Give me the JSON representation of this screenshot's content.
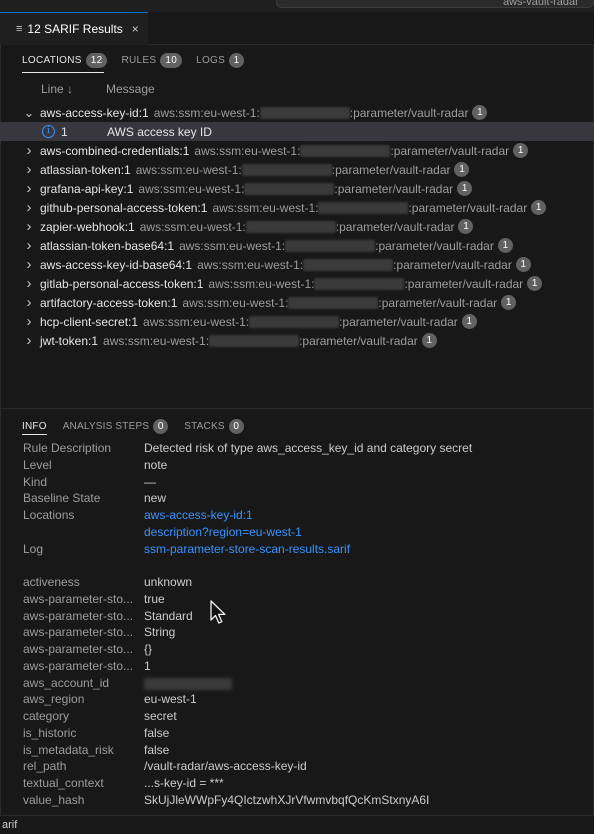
{
  "topbar": {
    "command_center_text": "aws-vault-radar"
  },
  "tab": {
    "icon": "list-icon",
    "title": "12 SARIF Results",
    "close": "×"
  },
  "subtabs": [
    {
      "label": "LOCATIONS",
      "count": "12",
      "active": true
    },
    {
      "label": "RULES",
      "count": "10",
      "active": false
    },
    {
      "label": "LOGS",
      "count": "1",
      "active": false
    }
  ],
  "columns": {
    "line": "Line",
    "sort_icon": "↓",
    "message": "Message"
  },
  "results": [
    {
      "name": "aws-access-key-id:1",
      "loc_prefix": "aws:ssm:eu-west-1:",
      "loc_suffix": ":parameter/vault-radar",
      "count": "1",
      "expanded": true
    },
    {
      "name": "aws-combined-credentials:1",
      "loc_prefix": "aws:ssm:eu-west-1:",
      "loc_suffix": ":parameter/vault-radar",
      "count": "1"
    },
    {
      "name": "atlassian-token:1",
      "loc_prefix": "aws:ssm:eu-west-1:",
      "loc_suffix": ":parameter/vault-radar",
      "count": "1"
    },
    {
      "name": "grafana-api-key:1",
      "loc_prefix": "aws:ssm:eu-west-1:",
      "loc_suffix": ":parameter/vault-radar",
      "count": "1"
    },
    {
      "name": "github-personal-access-token:1",
      "loc_prefix": "aws:ssm:eu-west-1:",
      "loc_suffix": ":parameter/vault-radar",
      "count": "1"
    },
    {
      "name": "zapier-webhook:1",
      "loc_prefix": "aws:ssm:eu-west-1:",
      "loc_suffix": ":parameter/vault-radar",
      "count": "1"
    },
    {
      "name": "atlassian-token-base64:1",
      "loc_prefix": "aws:ssm:eu-west-1:",
      "loc_suffix": ":parameter/vault-radar",
      "count": "1"
    },
    {
      "name": "aws-access-key-id-base64:1",
      "loc_prefix": "aws:ssm:eu-west-1:",
      "loc_suffix": ":parameter/vault-radar",
      "count": "1"
    },
    {
      "name": "gitlab-personal-access-token:1",
      "loc_prefix": "aws:ssm:eu-west-1:",
      "loc_suffix": ":parameter/vault-radar",
      "count": "1"
    },
    {
      "name": "artifactory-access-token:1",
      "loc_prefix": "aws:ssm:eu-west-1:",
      "loc_suffix": ":parameter/vault-radar",
      "count": "1"
    },
    {
      "name": "hcp-client-secret:1",
      "loc_prefix": "aws:ssm:eu-west-1:",
      "loc_suffix": ":parameter/vault-radar",
      "count": "1"
    },
    {
      "name": "jwt-token:1",
      "loc_prefix": "aws:ssm:eu-west-1:",
      "loc_suffix": ":parameter/vault-radar",
      "count": "1"
    }
  ],
  "child": {
    "icon": "info-icon",
    "line": "1",
    "message": "AWS access key ID"
  },
  "info_tabs": [
    {
      "label": "INFO",
      "active": true
    },
    {
      "label": "ANALYSIS STEPS",
      "count": "0"
    },
    {
      "label": "STACKS",
      "count": "0"
    }
  ],
  "info": [
    {
      "key": "Rule Description",
      "value": "Detected risk of type aws_access_key_id and category secret"
    },
    {
      "key": "Level",
      "value": "note"
    },
    {
      "key": "Kind",
      "value": "—"
    },
    {
      "key": "Baseline State",
      "value": "new"
    },
    {
      "key": "Locations",
      "value": "aws-access-key-id:1",
      "link": true
    },
    {
      "key": "",
      "value": "description?region=eu-west-1",
      "link": true
    },
    {
      "key": "Log",
      "value": "ssm-parameter-store-scan-results.sarif",
      "link": true
    },
    {
      "key": "",
      "value": ""
    },
    {
      "key": "activeness",
      "value": "unknown"
    },
    {
      "key": "aws-parameter-sto...",
      "value": "true"
    },
    {
      "key": "aws-parameter-sto...",
      "value": "Standard"
    },
    {
      "key": "aws-parameter-sto...",
      "value": "String"
    },
    {
      "key": "aws-parameter-sto...",
      "value": "{}"
    },
    {
      "key": "aws-parameter-sto...",
      "value": "1"
    },
    {
      "key": "aws_account_id",
      "value": "",
      "redacted": true
    },
    {
      "key": "aws_region",
      "value": "eu-west-1"
    },
    {
      "key": "category",
      "value": "secret"
    },
    {
      "key": "is_historic",
      "value": "false"
    },
    {
      "key": "is_metadata_risk",
      "value": "false"
    },
    {
      "key": "rel_path",
      "value": "/vault-radar/aws-access-key-id"
    },
    {
      "key": "textual_context",
      "value": "...s-key-id = ***"
    },
    {
      "key": "value_hash",
      "value": "SkUjJleWWpFy4QIctzwhXJrVfwmvbqfQcKmStxnyA6I"
    }
  ],
  "statusbar": {
    "text": "arif"
  }
}
